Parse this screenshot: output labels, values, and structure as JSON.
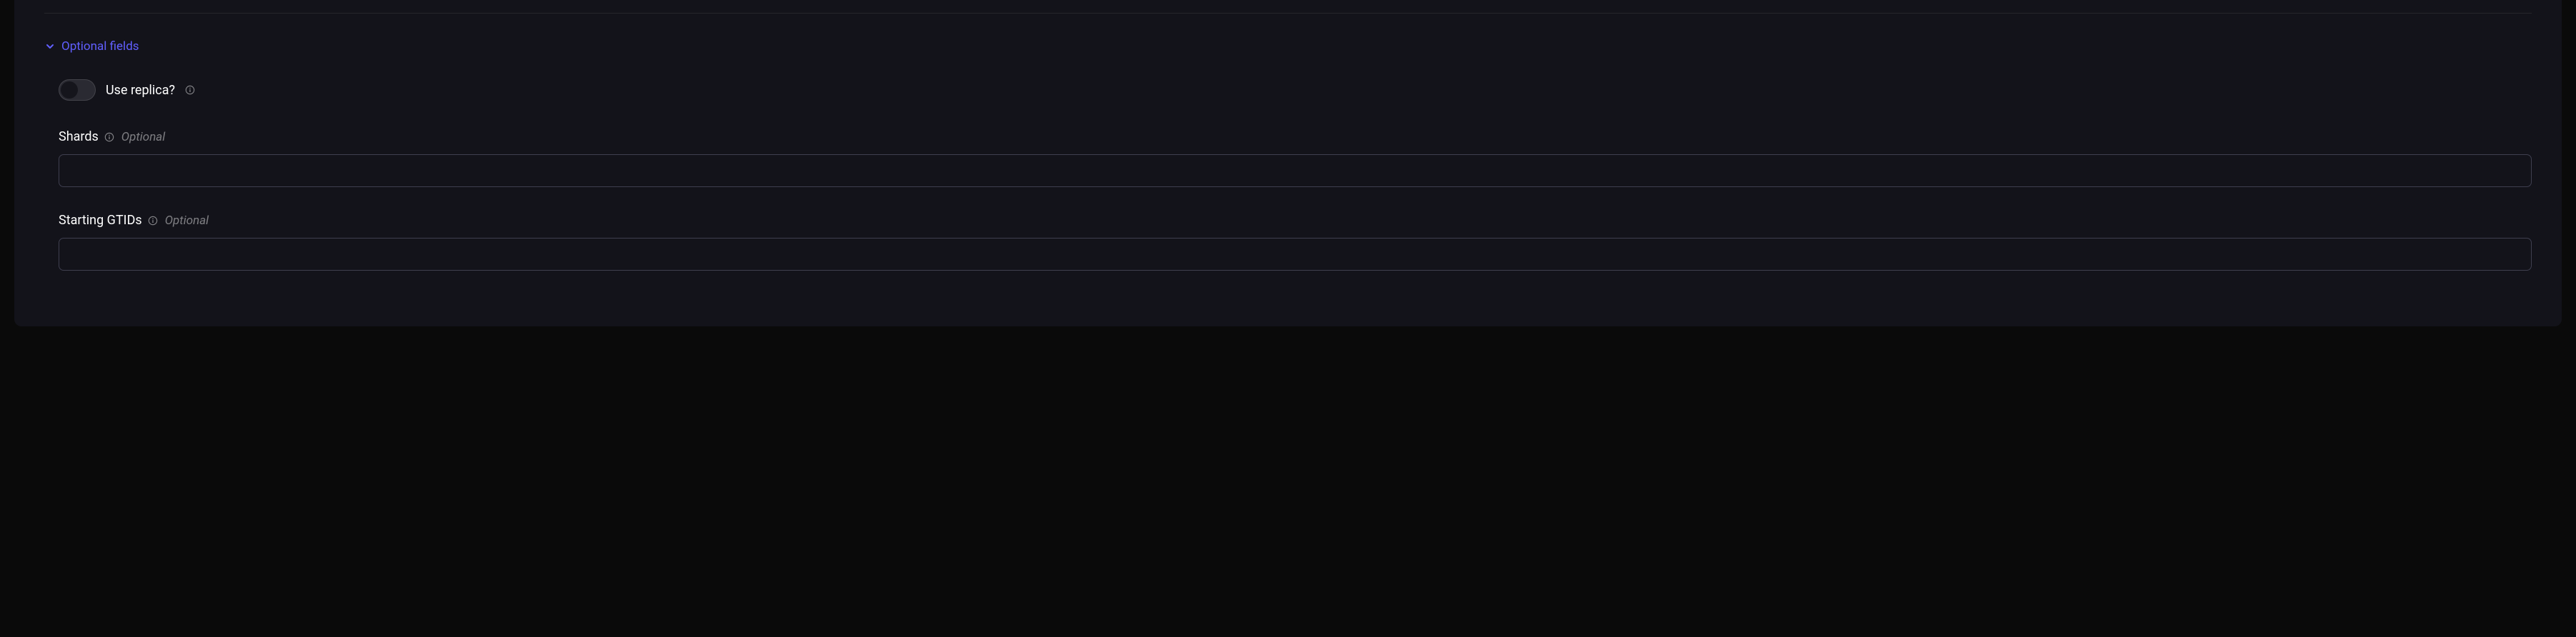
{
  "section": {
    "header_label": "Optional fields"
  },
  "fields": {
    "use_replica": {
      "label": "Use replica?",
      "value": false
    },
    "shards": {
      "label": "Shards",
      "hint": "Optional",
      "value": ""
    },
    "starting_gtids": {
      "label": "Starting GTIDs",
      "hint": "Optional",
      "value": ""
    }
  }
}
